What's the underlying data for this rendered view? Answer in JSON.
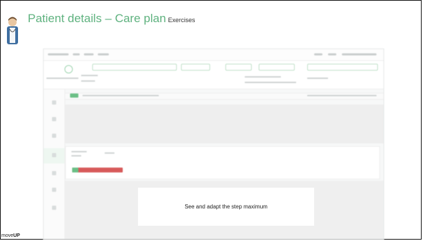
{
  "slide": {
    "title": "Patient details – Care plan",
    "subtitle": "Exercises"
  },
  "callout": {
    "text": "See and adapt the step maximum"
  },
  "branding": {
    "logo_prefix": "move",
    "logo_suffix": "UP"
  },
  "colors": {
    "title_green": "#5fb27f",
    "step_bar_red": "#d75a5a",
    "step_bar_green": "#6bbf86"
  },
  "icons": [
    "physician-avatar-icon",
    "profile-ring-icon",
    "nav-icons"
  ]
}
